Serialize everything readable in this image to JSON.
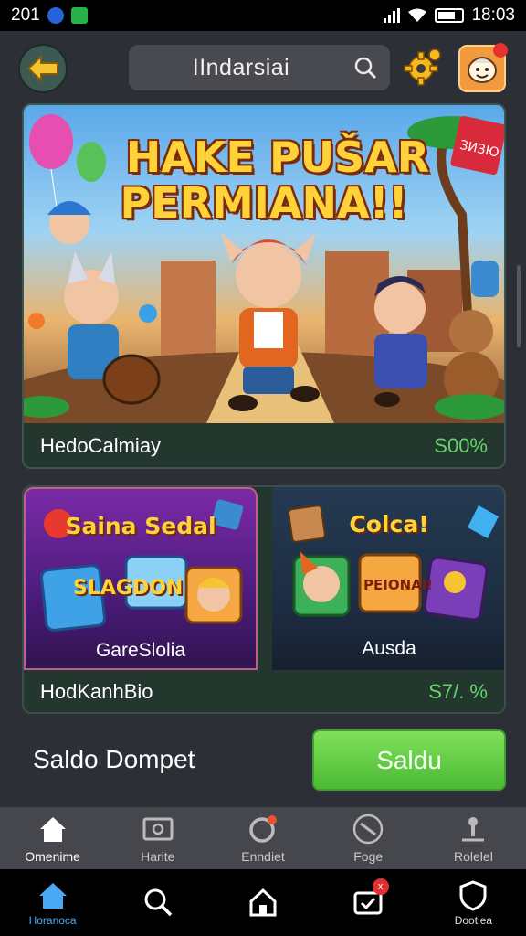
{
  "status_bar": {
    "left_text": "201",
    "time": "18:03"
  },
  "header": {
    "search_text": "IIndarsiai",
    "back_icon": "arrow-left-icon",
    "settings_icon": "gear-icon",
    "avatar_icon": "mascot-avatar-icon"
  },
  "hero": {
    "title_line1": "HAKE PUŠAR",
    "title_line2": "PERMIANA!!",
    "corner_sign": "ЗИЗЮ",
    "footer_label": "HedoCalmiay",
    "footer_value": "S00%"
  },
  "games": {
    "items": [
      {
        "title": "Saina Sedal",
        "art_text": "SLAGDON",
        "name": "GareSlolia",
        "icon": "fruit-icon"
      },
      {
        "title": "Colca!",
        "art_text": "PEIONAI!",
        "name": "Ausda",
        "icon": "crystal-icon"
      }
    ],
    "footer_label": "HodKanhBio",
    "footer_value": "S7/. %"
  },
  "wallet": {
    "label": "Saldo Dompet",
    "button_label": "Saldu"
  },
  "inner_nav": [
    {
      "label": "Omenime",
      "icon": "home-icon"
    },
    {
      "label": "Harite",
      "icon": "screen-icon"
    },
    {
      "label": "Enndiet",
      "icon": "refresh-icon"
    },
    {
      "label": "Foge",
      "icon": "compass-icon"
    },
    {
      "label": "Rolelel",
      "icon": "user-icon"
    }
  ],
  "bottom_nav": [
    {
      "label": "Horanoca",
      "icon": "home-icon"
    },
    {
      "label": "",
      "icon": "search-icon"
    },
    {
      "label": "",
      "icon": "house-outline-icon"
    },
    {
      "label": "",
      "icon": "messages-icon",
      "badge": "x"
    },
    {
      "label": "Dootiea",
      "icon": "shield-icon"
    }
  ],
  "colors": {
    "accent_green": "#4cba34",
    "active_blue": "#4aa8f5",
    "percent_green": "#63d66a"
  }
}
